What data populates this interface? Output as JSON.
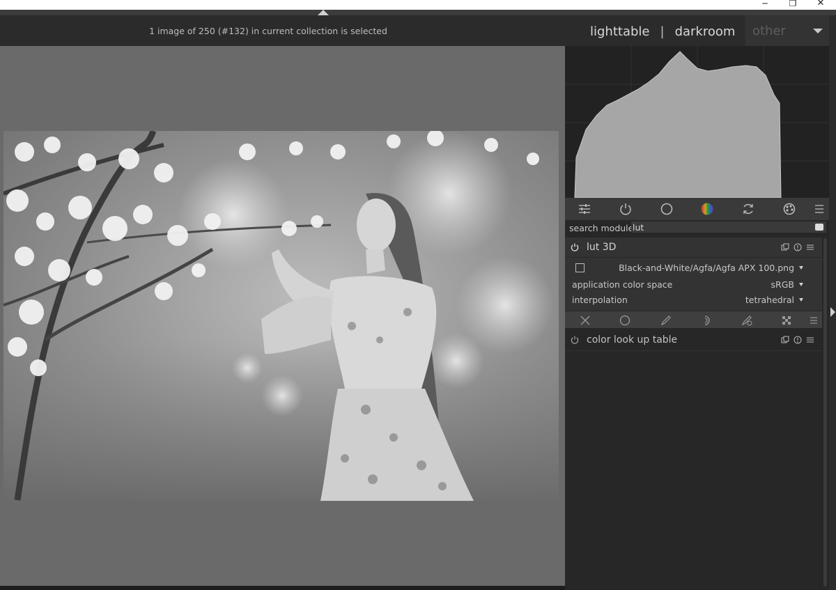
{
  "window": {
    "minimize": "─",
    "maximize": "❐",
    "close": "✕"
  },
  "header": {
    "status_text": "1 image of 250 (#132) in current collection is selected",
    "views": [
      "lighttable",
      "darkroom"
    ],
    "separator": "|",
    "other_label": "other"
  },
  "search": {
    "label": "search module",
    "value": "lut"
  },
  "modules": {
    "lut3d": {
      "name": "lut 3D",
      "lut_file": "Black-and-White/Agfa/Agfa APX 100.png",
      "rows": [
        {
          "label": "application color space",
          "value": "sRGB"
        },
        {
          "label": "interpolation",
          "value": "tetrahedral"
        }
      ]
    },
    "colorlut": {
      "name": "color look up table"
    }
  },
  "icons": {
    "tabs": [
      "sliders-icon",
      "power-icon",
      "circle-icon",
      "color-wheel-icon",
      "refresh-icon",
      "palette-icon",
      "hamburger-menu-icon"
    ],
    "mask_bar": [
      "mask-off-icon",
      "uniform-mask-icon",
      "drawn-mask-icon",
      "parametric-mask-icon",
      "drawn-parametric-mask-icon",
      "raster-mask-icon",
      "blend-menu-icon"
    ]
  },
  "colors": {
    "panel": "#272727",
    "header": "#2b2b2b",
    "image_bg": "#6a6a6a",
    "active_tab": "#1f8f3a"
  }
}
